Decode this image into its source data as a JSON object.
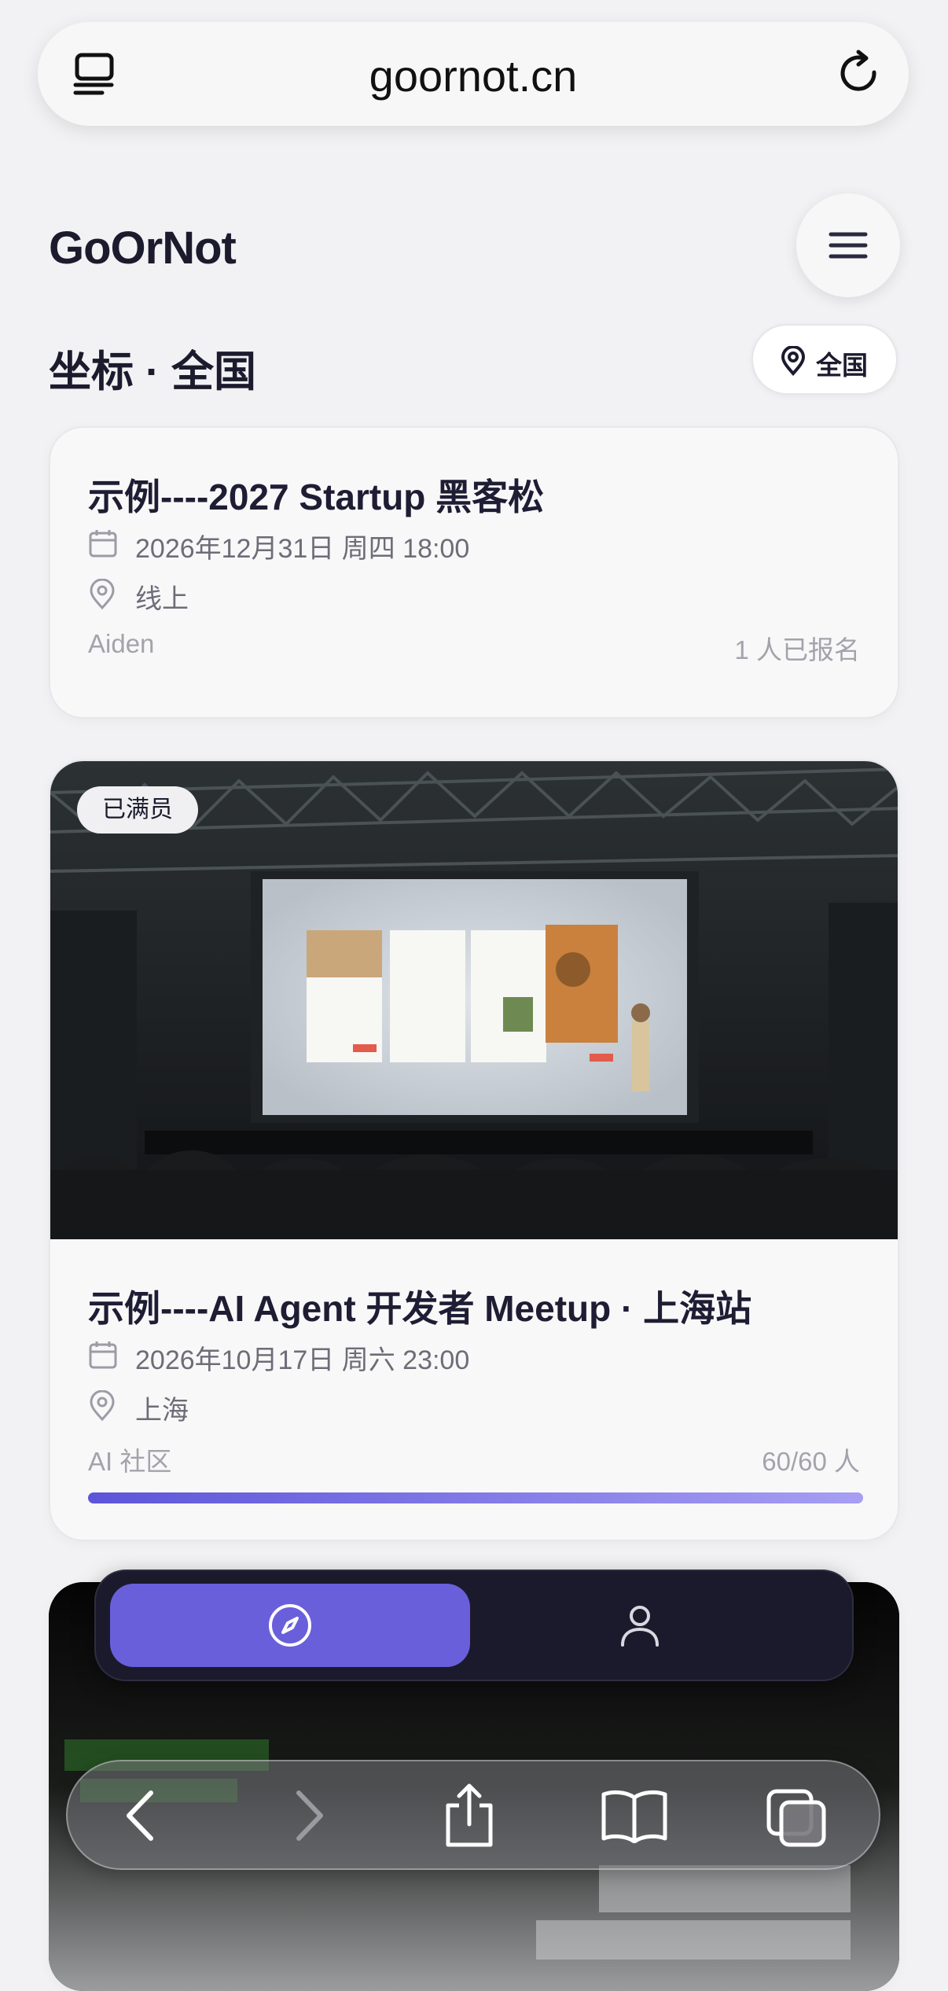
{
  "browser": {
    "url": "goornot.cn",
    "icons": {
      "tabs": "tab-overview-icon",
      "reload": "reload-icon"
    }
  },
  "header": {
    "brand": "GoOrNot",
    "menu_icon": "hamburger-menu-icon"
  },
  "location": {
    "title": "坐标 · 全国",
    "button_label": "全国"
  },
  "events": [
    {
      "title": "示例----2027 Startup 黑客松",
      "datetime": "2026年12月31日 周四 18:00",
      "place": "线上",
      "organizer": "Aiden",
      "attendance": "1 人已报名"
    },
    {
      "badge": "已满员",
      "title": "示例----AI Agent 开发者 Meetup · 上海站",
      "datetime": "2026年10月17日 周六 23:00",
      "place": "上海",
      "organizer": "AI 社区",
      "attendance": "60/60 人",
      "fill_fraction": 1.0
    }
  ],
  "bottom_nav": {
    "tabs": [
      "explore-compass-icon",
      "profile-icon"
    ],
    "active": 0
  },
  "safari_toolbar": [
    "back-icon",
    "forward-icon",
    "share-icon",
    "bookmarks-icon",
    "tabs-icon"
  ],
  "colors": {
    "accent": "#6a5fdb",
    "nav_bg": "#1b1a2c",
    "text": "#1c1b2e"
  }
}
